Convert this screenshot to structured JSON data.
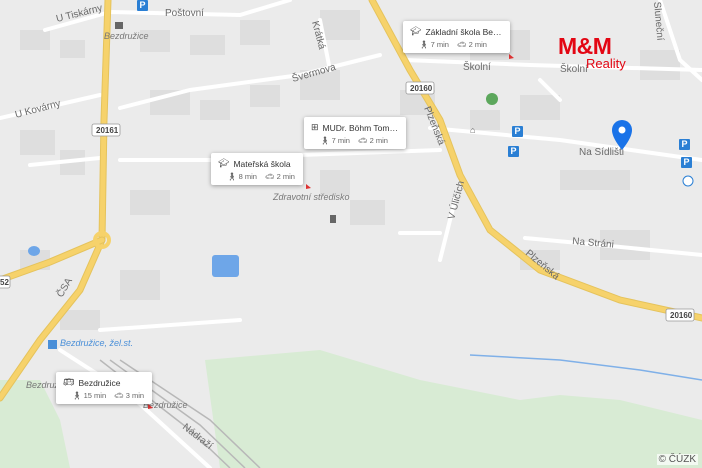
{
  "streets": {
    "u_tiskarny": "U Tiskárny",
    "postovni": "Poštovní",
    "kratka": "Krátká",
    "svermova": "Švermova",
    "u_kovarny": "U Kovárny",
    "ra": "ra",
    "skolni_1": "Školní",
    "skolni_2": "Školní",
    "na_sidlisti": "Na Sídlišti",
    "plzenska_1": "Plzeňská",
    "plzenska_2": "Plzeňská",
    "v_ulicich": "V Úličích",
    "na_strani": "Na Stráni",
    "nadrazi": "Nádraží",
    "csa": "ČSA",
    "slunecni": "Sluneční"
  },
  "road_numbers": {
    "r20161": "20161",
    "r20160_a": "20160",
    "r20160_b": "20160",
    "r_edge": "52"
  },
  "place_labels": {
    "bezdruzice_top": "Bezdružice",
    "bezdruzice_left": "Bezdružice",
    "bezdruzice_bottom": "Bezdružice",
    "bezdruzice_station": "Bezdružice, žel.st.",
    "zdravotni": "Zdravotní středisko"
  },
  "poi_cards": [
    {
      "title": "Základní škola Be…",
      "walk": "7 min",
      "car": "2 min",
      "icon": "school-icon"
    },
    {
      "title": "MUDr. Böhm Tom…",
      "walk": "7 min",
      "car": "2 min",
      "icon": "medical-icon"
    },
    {
      "title": "Mateřská škola",
      "walk": "8 min",
      "car": "2 min",
      "icon": "school-icon"
    },
    {
      "title": "Bezdružice",
      "walk": "15 min",
      "car": "3 min",
      "icon": "bus-icon"
    }
  ],
  "logo": {
    "brand": "M&M",
    "sub": "Reality"
  },
  "parking": "P",
  "copyright": "© ČÚZK",
  "colors": {
    "brand": "#e30613",
    "pin": "#1a73e8",
    "road_major": "#f6d26b",
    "water": "#6ea6e8"
  }
}
